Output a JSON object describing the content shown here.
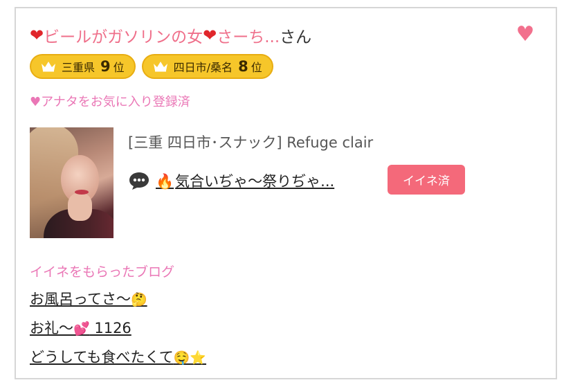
{
  "profile": {
    "name_heart_left": "❤",
    "name_text": "ビールがガソリンの女",
    "name_heart_mid": "❤",
    "name_tail": "さーち...",
    "honorific": "さん",
    "favorite_icon": "heart-icon",
    "favorite_color": "#f2708d"
  },
  "badges": [
    {
      "icon": "crown-icon",
      "label": "三重県",
      "rank": "9",
      "suffix": "位"
    },
    {
      "icon": "crown-icon",
      "label": "四日市/桑名",
      "rank": "8",
      "suffix": "位"
    }
  ],
  "favorite_status": "♥アナタをお気に入り登録済",
  "shop": {
    "category": "[三重 四日市･スナック]",
    "name": "Refuge clair"
  },
  "post": {
    "icon": "speech-bubble-icon",
    "emoji": "🔥",
    "title": "気合いぢゃ〜祭りぢゃ...",
    "like_label": "イイネ済",
    "like_color": "#f4697a"
  },
  "blog": {
    "heading": "イイネをもらったブログ",
    "items": [
      {
        "text": "お風呂ってさ〜",
        "emoji": "🤔",
        "extra": ""
      },
      {
        "text": "お礼〜",
        "emoji": "💕",
        "extra": " 1126"
      },
      {
        "text": "どうしても食べたくて",
        "emoji": "🤤⭐",
        "extra": ""
      }
    ]
  }
}
